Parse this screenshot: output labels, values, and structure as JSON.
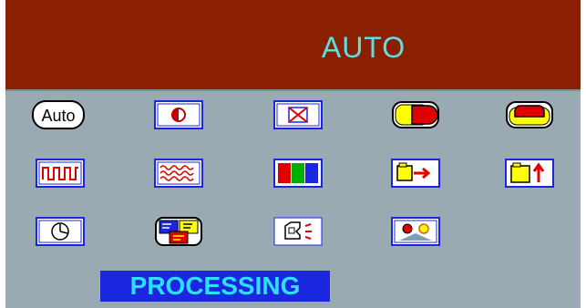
{
  "osd": {
    "title": "AUTO",
    "status": "PROCESSING",
    "colors": {
      "background": "#99aab3",
      "header": "#8b2000",
      "title_text": "#5de0e3",
      "status_background": "#1b26e0",
      "status_text": "#2ee0ff",
      "icon_blue": "#1b26e0",
      "icon_red": "#e00000",
      "icon_yellow": "#ffff00"
    },
    "menu": {
      "auto_icon_label": "Auto"
    }
  }
}
